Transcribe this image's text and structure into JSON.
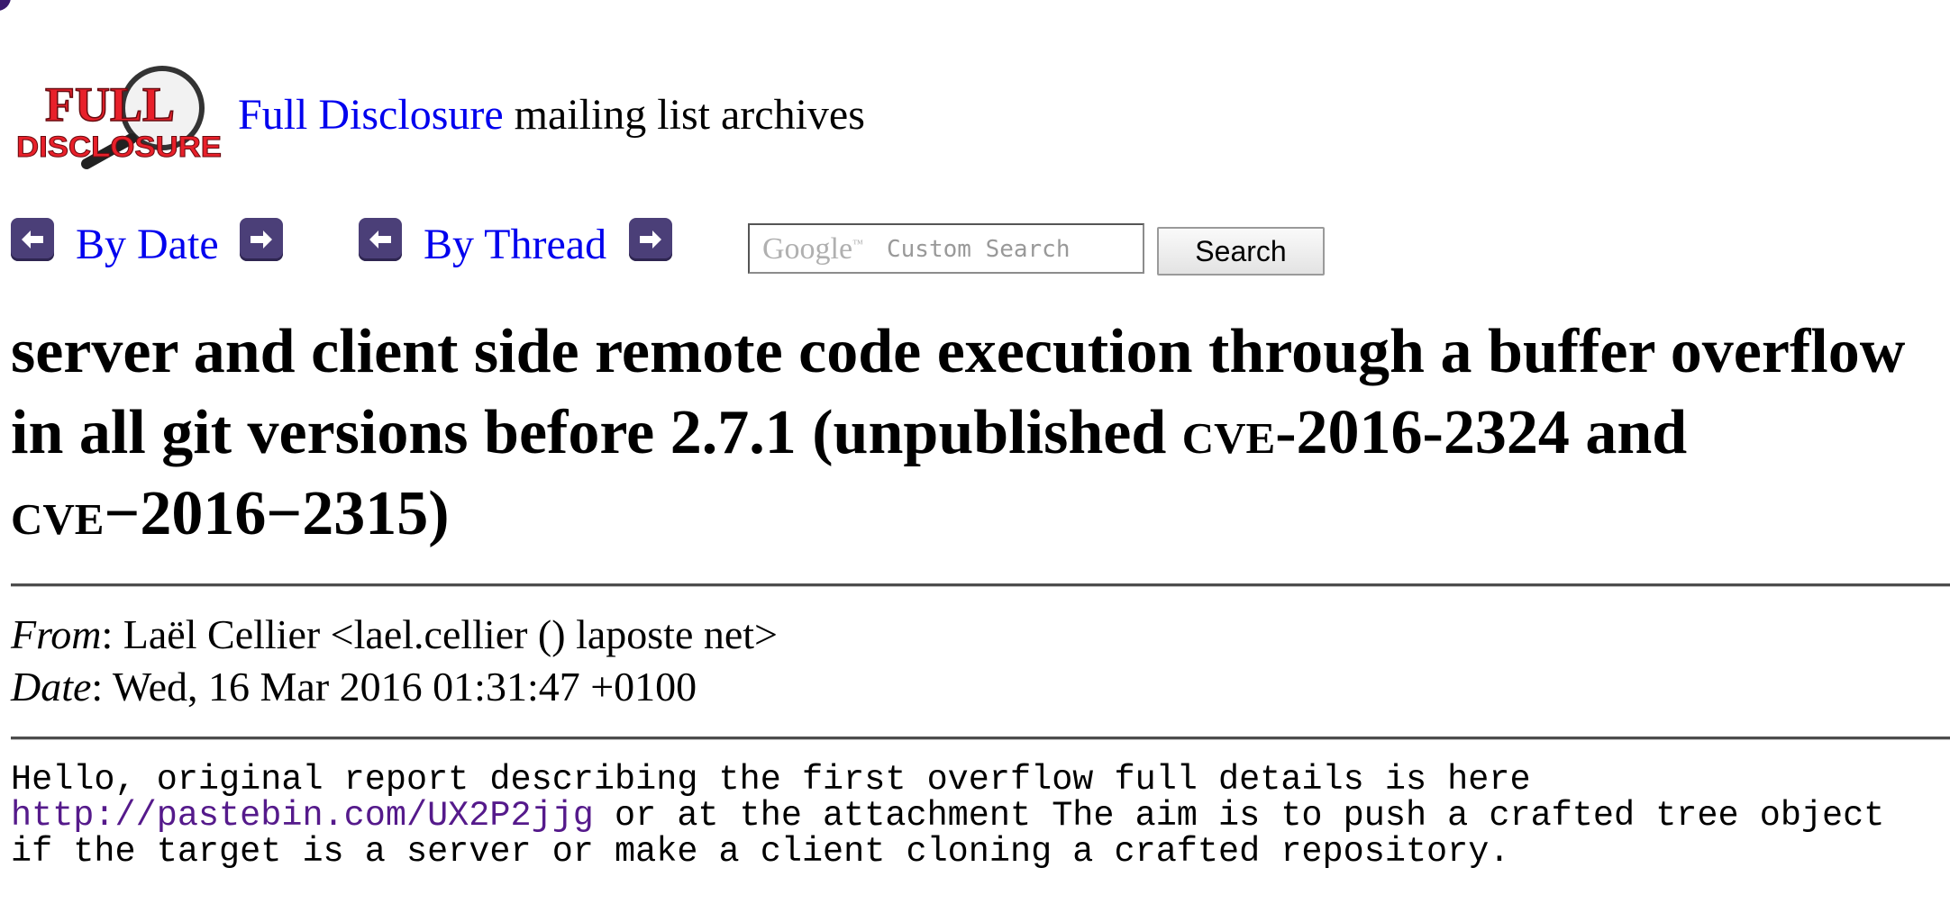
{
  "header": {
    "logo_text_top": "FULL",
    "logo_text_bottom": "DISCLOSURE",
    "site_link": "Full Disclosure",
    "site_suffix": " mailing list archives"
  },
  "nav": {
    "by_date": "By Date",
    "by_thread": "By Thread",
    "search_brand": "Google",
    "search_hint": "Custom Search",
    "search_button": "Search"
  },
  "message": {
    "title_1": "server and client side remote code execution through a buffer overflow in all git versions before 2.7.1 (unpublished ",
    "title_cve1": "cve",
    "title_2": "-2016-2324 and ",
    "title_cve2": "cve",
    "title_3": "−2016−2315)",
    "from_label": "From",
    "from_value": ": Laël Cellier <lael.cellier () laposte net>",
    "date_label": "Date",
    "date_value": ": Wed, 16 Mar 2016 01:31:47 +0100",
    "body_line1": "Hello, original report describing the first overflow full details is here",
    "body_link": "http://pastebin.com/UX2P2jjg",
    "body_line2_rest": " or at the attachment The aim is to push a crafted tree object",
    "body_line3": "if the target is a server or make a client cloning a crafted repository."
  },
  "colors": {
    "link": "#0000ee",
    "visited_link": "#551a8b",
    "nav_button": "#4b3f78",
    "logo_red": "#e8202a"
  },
  "icons": {
    "prev": "arrow-left-icon",
    "next": "arrow-right-icon",
    "logo": "magnifier-logo"
  }
}
